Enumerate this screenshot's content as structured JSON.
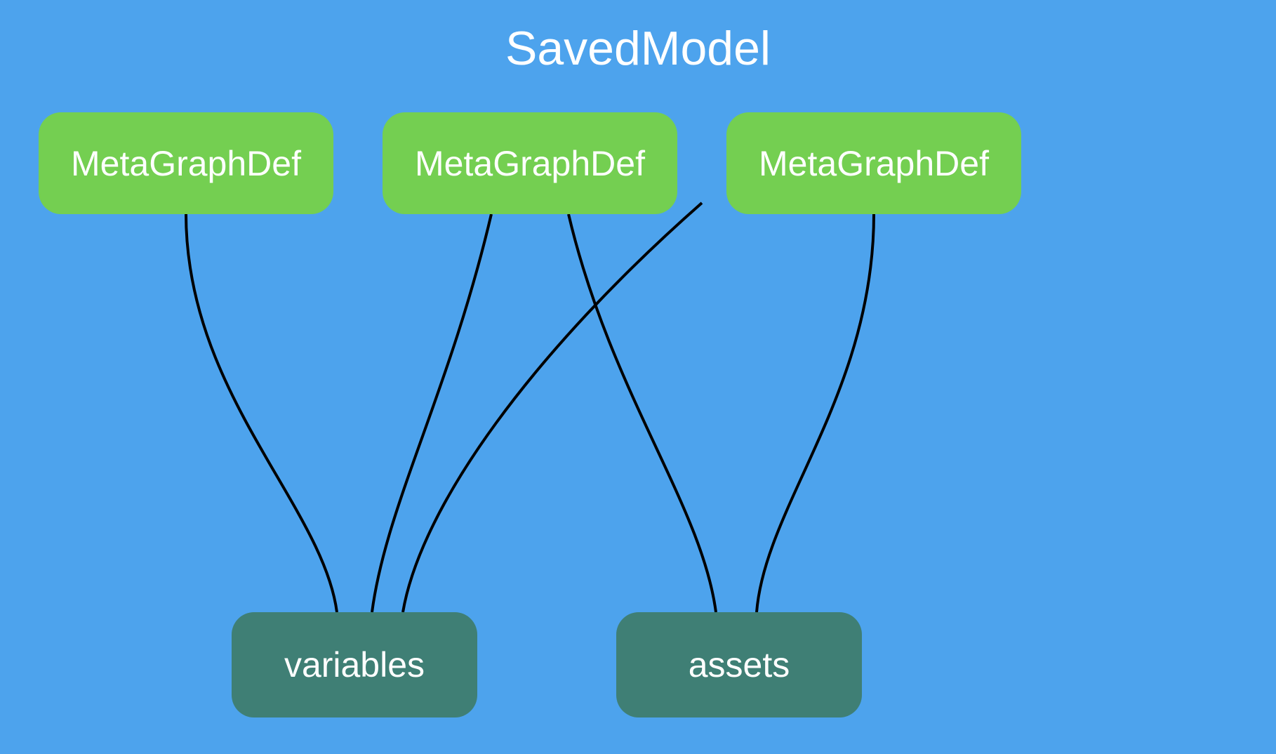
{
  "title": "SavedModel",
  "nodes": {
    "mg1": "MetaGraphDef",
    "mg2": "MetaGraphDef",
    "mg3": "MetaGraphDef",
    "variables": "variables",
    "assets": "assets"
  },
  "colors": {
    "background": "#4DA3ED",
    "node_green": "#74CF51",
    "node_teal": "#3F7F75",
    "text": "#ffffff",
    "edge": "#000000"
  },
  "edges": [
    {
      "from": "mg1",
      "to": "variables"
    },
    {
      "from": "mg2",
      "to": "variables"
    },
    {
      "from": "mg2",
      "to": "assets"
    },
    {
      "from": "mg3",
      "to": "variables"
    },
    {
      "from": "mg3",
      "to": "assets"
    }
  ]
}
